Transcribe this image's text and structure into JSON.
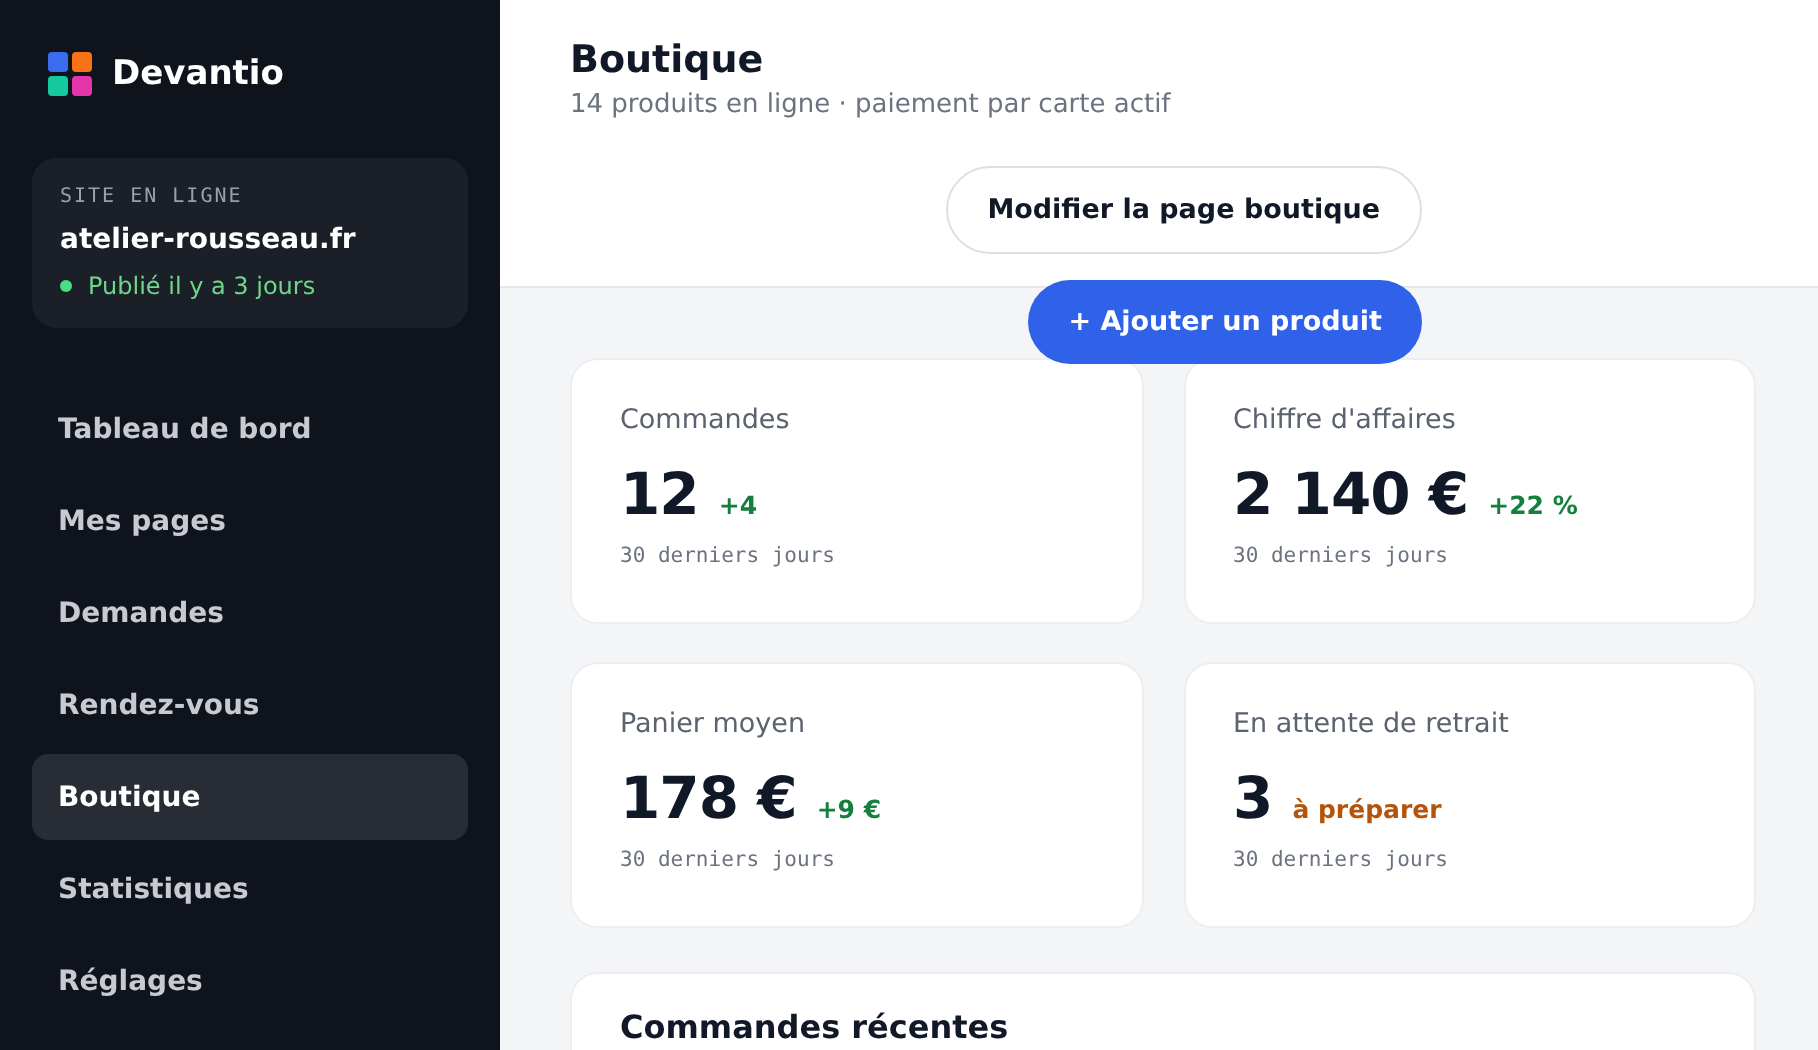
{
  "sidebar": {
    "brand": "Devantio",
    "site_card": {
      "label": "SITE EN LIGNE",
      "domain": "atelier-rousseau.fr",
      "status": "Publié il y a 3 jours",
      "online": true
    },
    "items": [
      {
        "label": "Tableau de bord",
        "selected": false
      },
      {
        "label": "Mes pages",
        "selected": false
      },
      {
        "label": "Demandes",
        "selected": false
      },
      {
        "label": "Rendez-vous",
        "selected": false
      },
      {
        "label": "Boutique",
        "selected": true
      },
      {
        "label": "Statistiques",
        "selected": false
      },
      {
        "label": "Réglages",
        "selected": false
      }
    ]
  },
  "header": {
    "title": "Boutique",
    "subtitle": "14 produits en ligne · paiement par carte actif"
  },
  "actions": [
    {
      "label": "Modifier la page boutique",
      "kind": "secondary"
    },
    {
      "label": "+ Ajouter un produit",
      "kind": "primary"
    }
  ],
  "stats": [
    {
      "label": "Commandes",
      "value": "12",
      "delta": "+4",
      "kind": "up",
      "period": "30 derniers jours"
    },
    {
      "label": "Chiffre d'affaires",
      "value": "2 140 €",
      "delta": "+22 %",
      "kind": "up",
      "period": "30 derniers jours"
    },
    {
      "label": "Panier moyen",
      "value": "178 €",
      "delta": "+9 €",
      "kind": "up",
      "period": "30 derniers jours"
    },
    {
      "label": "En attente de retrait",
      "value": "3",
      "delta": "à préparer",
      "kind": "pending",
      "period": "30 derniers jours"
    }
  ],
  "recent_orders": {
    "title": "Commandes récentes"
  }
}
